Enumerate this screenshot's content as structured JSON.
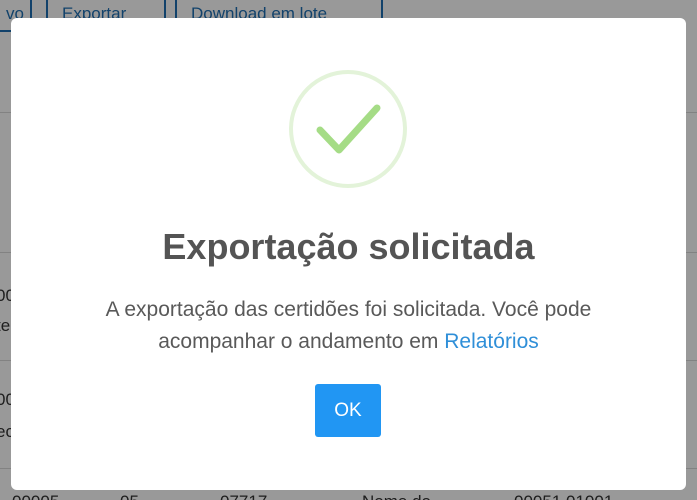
{
  "background": {
    "toolbar": {
      "button_1_label": "vo",
      "export_label": "Exportar",
      "batch_download_label": "Download em lote"
    },
    "rows": [
      {
        "line_1": "00",
        "line_2": "te"
      },
      {
        "line_1": "00",
        "line_2": "ec"
      }
    ],
    "bottom_row": [
      "00005",
      "05",
      "07717",
      "Nome do",
      "00051 01001"
    ]
  },
  "modal": {
    "icon": "success-check-icon",
    "title": "Exportação solicitada",
    "message": "A exportação das certidões foi solicitada. Você pode acompanhar o andamento em ",
    "link_text": "Relatórios",
    "ok_label": "OK",
    "colors": {
      "check": "#a5dc86",
      "ring": "#e3f3d9",
      "link": "#2f8fd8",
      "button": "#2196f3"
    }
  }
}
